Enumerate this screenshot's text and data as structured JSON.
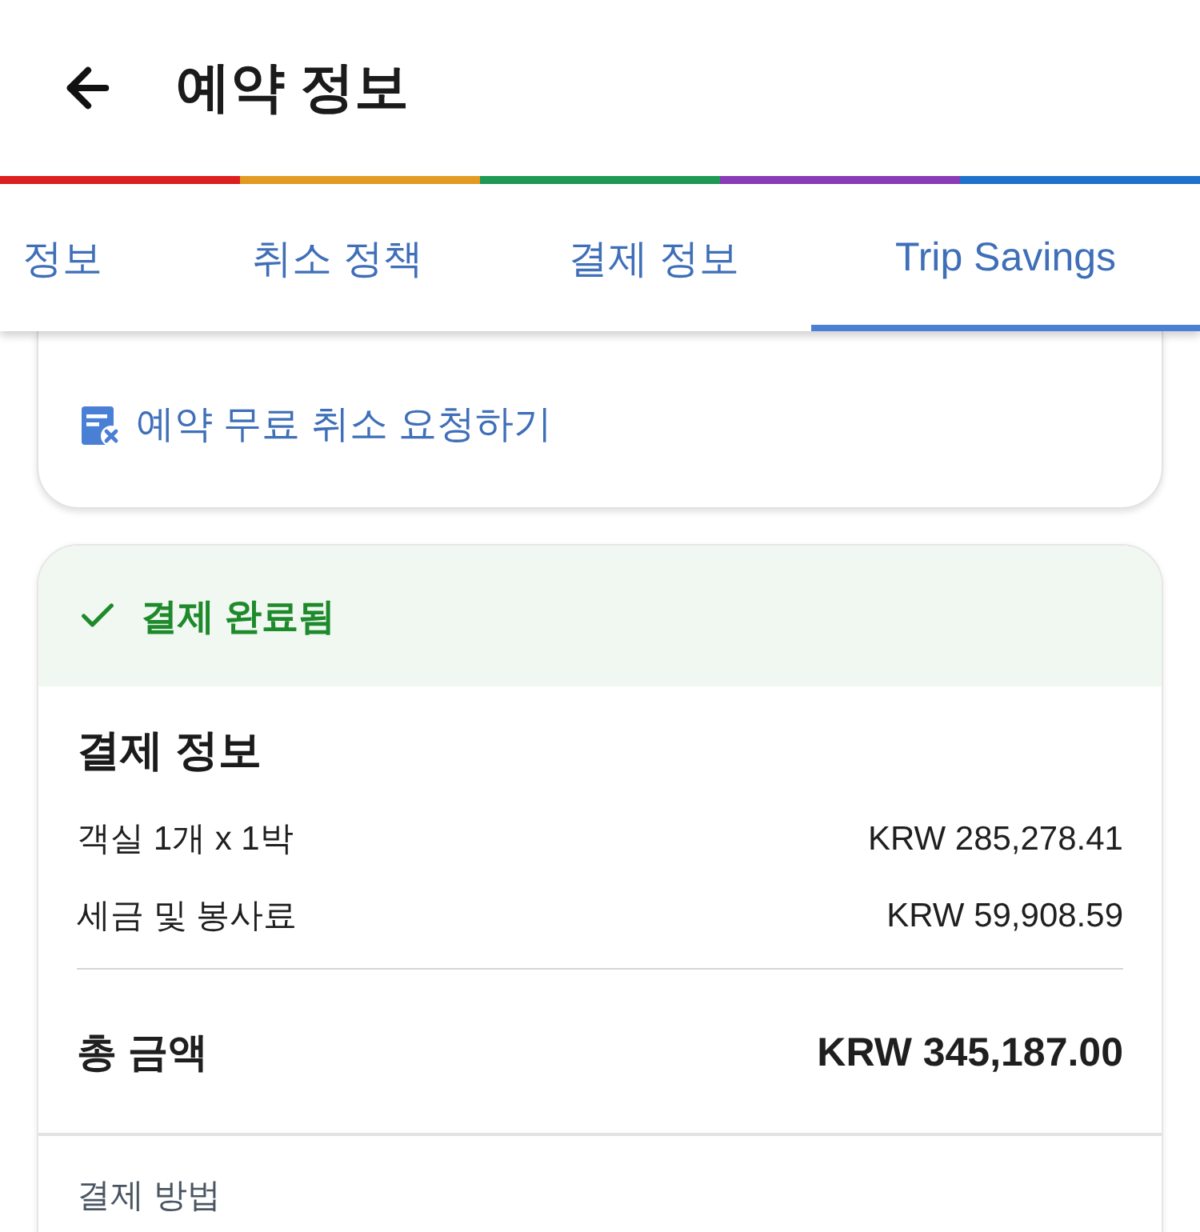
{
  "header": {
    "title": "예약 정보"
  },
  "tabs": [
    {
      "label": "정보",
      "selected": false
    },
    {
      "label": "취소 정책",
      "selected": false
    },
    {
      "label": "결제 정보",
      "selected": false
    },
    {
      "label": "Trip Savings",
      "selected": true
    }
  ],
  "cancel_card": {
    "link": "예약 무료 취소 요청하기"
  },
  "payment_card": {
    "status": {
      "label": "결제 완료됨"
    },
    "title": "결제 정보",
    "items": [
      {
        "label": "객실 1개 x 1박",
        "amount": "KRW 285,278.41"
      },
      {
        "label": "세금 및 봉사료",
        "amount": "KRW 59,908.59"
      }
    ],
    "total": {
      "label": "총 금액",
      "amount": "KRW 345,187.00"
    },
    "payment_method": {
      "label": "결제 방법"
    }
  }
}
